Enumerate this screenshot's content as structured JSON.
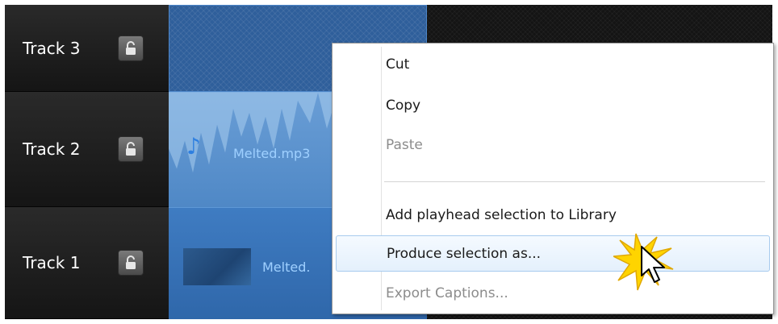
{
  "tracks": [
    {
      "name": "Track 3",
      "icon": "lock-icon"
    },
    {
      "name": "Track 2",
      "icon": "lock-icon"
    },
    {
      "name": "Track 1",
      "icon": "lock-icon"
    }
  ],
  "clips": {
    "track2_label": "Melted.mp3",
    "track1_label": "Melted."
  },
  "context_menu": {
    "items": [
      {
        "label": "Cut",
        "enabled": true
      },
      {
        "label": "Copy",
        "enabled": true
      },
      {
        "label": "Paste",
        "enabled": false
      },
      {
        "label": "Add playhead selection to Library",
        "enabled": true
      },
      {
        "label": "Produce selection as...",
        "enabled": true,
        "hovered": true
      },
      {
        "label": "Export Captions...",
        "enabled": false
      }
    ]
  },
  "colors": {
    "clip_blue": "#4f88c6",
    "menu_hover_border": "#a8cbee",
    "click_highlight": "#ffd400"
  }
}
